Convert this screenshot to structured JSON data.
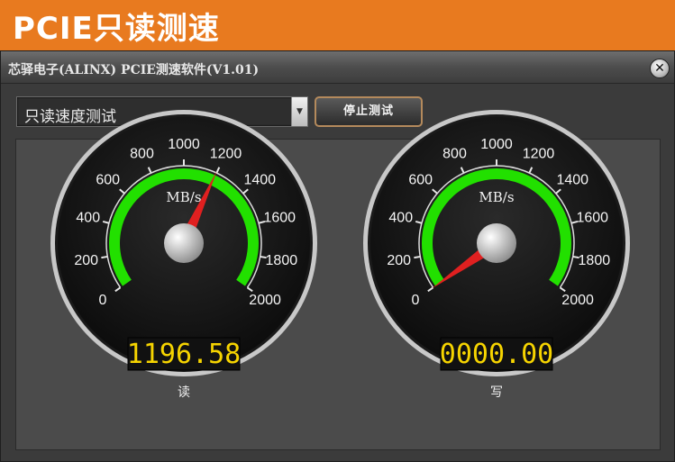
{
  "banner": {
    "title": "PCIE只读测速"
  },
  "window": {
    "title": "芯驿电子(ALINX) PCIE测速软件(V1.01)",
    "close_icon": "close-icon"
  },
  "controls": {
    "mode_select_value": "只读速度测试",
    "stop_button_label": "停止测试"
  },
  "colors": {
    "accent": "#e87a1f",
    "arc": "#22e000",
    "needle": "#e02020",
    "display": "#f6d400"
  },
  "gauges": [
    {
      "unit": "MB/s",
      "ticks": [
        "0",
        "200",
        "400",
        "600",
        "800",
        "1000",
        "1200",
        "1400",
        "1600",
        "1800",
        "2000"
      ],
      "min": 0,
      "max": 2000,
      "value": 1196.58,
      "display": "1196.58",
      "label": "读"
    },
    {
      "unit": "MB/s",
      "ticks": [
        "0",
        "200",
        "400",
        "600",
        "800",
        "1000",
        "1200",
        "1400",
        "1600",
        "1800",
        "2000"
      ],
      "min": 0,
      "max": 2000,
      "value": 0,
      "display": "0000.00",
      "label": "写"
    }
  ]
}
